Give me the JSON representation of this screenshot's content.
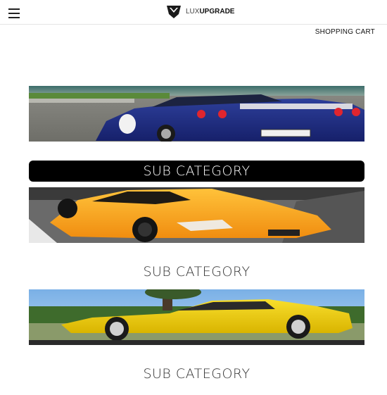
{
  "header": {
    "logo": {
      "word_light": "LUX",
      "word_bold": "UPGRADE"
    },
    "shopping_cart_label": "SHOPPING CART"
  },
  "categories": [
    {
      "label": "SUB CATEGORY",
      "image": "blue-race-car-rear",
      "active": true
    },
    {
      "label": "SUB CATEGORY",
      "image": "orange-supercar-front",
      "active": false
    },
    {
      "label": "SUB CATEGORY",
      "image": "yellow-classic-sports-car-side",
      "active": false
    }
  ],
  "colors": {
    "active_label_bg": "#000000",
    "active_label_text": "#ffffff",
    "label_text": "#333333"
  }
}
